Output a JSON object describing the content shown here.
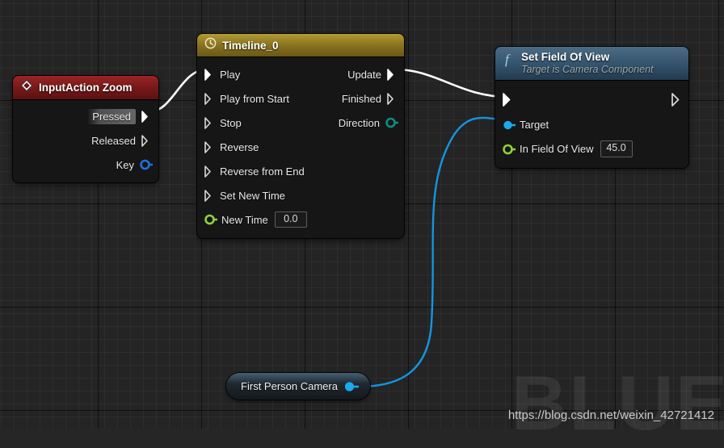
{
  "app": {
    "editor": "Unreal Engine Blueprint Graph",
    "background_color": "#242424",
    "grid_line_color": "#3a3a3a",
    "grid_major_color": "#000000"
  },
  "watermark": {
    "big_text": "BLUE",
    "url": "https://blog.csdn.net/weixin_42721412"
  },
  "nodes": {
    "input_action": {
      "title": "InputAction Zoom",
      "icon": "diamond-event-icon",
      "header_color": "#8a1f1f",
      "pins_out": [
        {
          "label": "Pressed",
          "type": "exec",
          "connected": true,
          "highlighted": true
        },
        {
          "label": "Released",
          "type": "exec",
          "connected": false,
          "highlighted": false
        },
        {
          "label": "Key",
          "type": "struct",
          "color": "#1f6fe0",
          "connected": false,
          "highlighted": false
        }
      ]
    },
    "timeline": {
      "title": "Timeline_0",
      "icon": "clock-icon",
      "header_color": "#8a7420",
      "pins_in": [
        {
          "label": "Play",
          "type": "exec",
          "connected": true
        },
        {
          "label": "Play from Start",
          "type": "exec",
          "connected": false
        },
        {
          "label": "Stop",
          "type": "exec",
          "connected": false
        },
        {
          "label": "Reverse",
          "type": "exec",
          "connected": false
        },
        {
          "label": "Reverse from End",
          "type": "exec",
          "connected": false
        },
        {
          "label": "Set New Time",
          "type": "exec",
          "connected": false
        },
        {
          "label": "New Time",
          "type": "float",
          "color": "#8fd13f",
          "value": "0.0",
          "connected": false
        }
      ],
      "pins_out": [
        {
          "label": "Update",
          "type": "exec",
          "connected": true
        },
        {
          "label": "Finished",
          "type": "exec",
          "connected": false
        },
        {
          "label": "Direction",
          "type": "enum",
          "color": "#0f8c84",
          "connected": false
        }
      ]
    },
    "set_field_of_view": {
      "title": "Set Field Of View",
      "subtitle": "Target is Camera Component",
      "icon": "function-f-icon",
      "header_color": "#33536c",
      "exec_in": {
        "type": "exec",
        "connected": true
      },
      "exec_out": {
        "type": "exec",
        "connected": false
      },
      "pins_in": [
        {
          "label": "Target",
          "type": "object",
          "color": "#19aaf0",
          "connected": true
        },
        {
          "label": "In Field Of View",
          "type": "float",
          "color": "#8fd13f",
          "value": "45.0",
          "connected": false
        }
      ]
    },
    "first_person_camera": {
      "label": "First Person Camera",
      "type": "variable-getter",
      "pin": {
        "type": "object",
        "color": "#19aaf0",
        "connected": true
      }
    }
  },
  "wires": [
    {
      "name": "pressed-to-play",
      "from": "input_action.Pressed",
      "to": "timeline.Play",
      "color": "#ffffff",
      "kind": "exec"
    },
    {
      "name": "update-to-setfov",
      "from": "timeline.Update",
      "to": "set_field_of_view.exec_in",
      "color": "#ffffff",
      "kind": "exec"
    },
    {
      "name": "camera-to-target",
      "from": "first_person_camera.pin",
      "to": "set_field_of_view.Target",
      "color": "#1296e0",
      "kind": "object"
    }
  ]
}
